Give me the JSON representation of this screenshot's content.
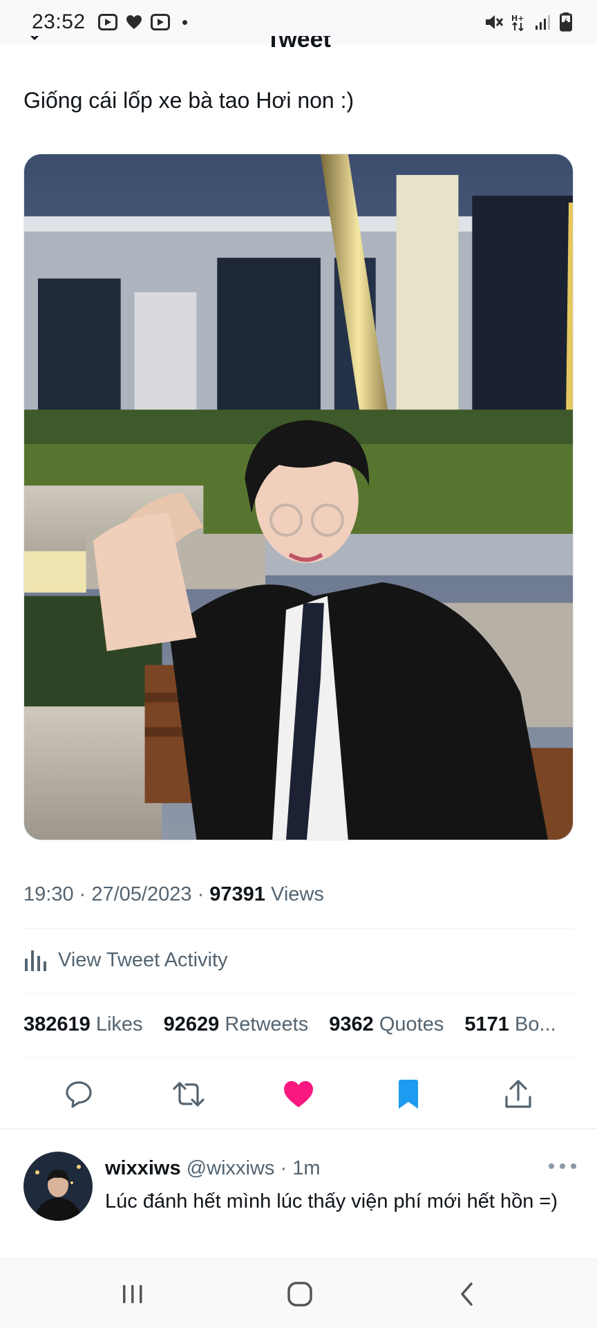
{
  "status_bar": {
    "time": "23:52",
    "left_icons": [
      "youtube-icon",
      "heart-icon",
      "youtube-icon"
    ],
    "right_icons": [
      "mute-icon",
      "data-arrows-icon",
      "signal-icon",
      "battery-icon"
    ]
  },
  "header": {
    "title": "Tweet"
  },
  "tweet": {
    "text": "Giống cái lốp xe bà tao Hơi non :)",
    "time": "19:30",
    "date": "27/05/2023",
    "views_count": "97391",
    "views_label": "Views",
    "activity_label": "View Tweet Activity",
    "stats": [
      {
        "count": "382619",
        "label": "Likes"
      },
      {
        "count": "92629",
        "label": "Retweets"
      },
      {
        "count": "9362",
        "label": "Quotes"
      },
      {
        "count": "5171",
        "label": "Bo..."
      }
    ],
    "actions": [
      "reply-icon",
      "retweet-icon",
      "like-icon",
      "bookmark-icon",
      "share-icon"
    ],
    "colors": {
      "like": "#f91880",
      "bookmark": "#1d9bf0"
    }
  },
  "reply": {
    "name": "wixxiws",
    "handle": "@wixxiws",
    "time": "1m",
    "text": "Lúc đánh hết mình lúc thấy viện phí mới hết hồn =)"
  },
  "nav_bar": {
    "buttons": [
      "recents-icon",
      "home-icon",
      "back-icon"
    ]
  }
}
